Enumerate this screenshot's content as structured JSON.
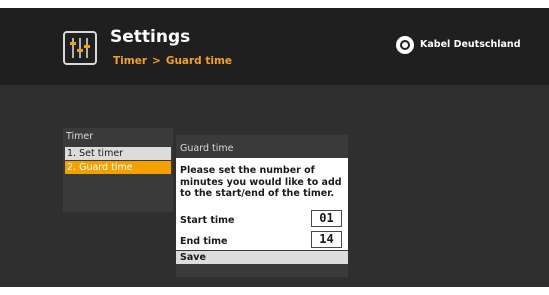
{
  "header": {
    "title": "Settings",
    "breadcrumb": {
      "parent": "Timer",
      "separator": ">",
      "current": "Guard time"
    },
    "brand": "Kabel Deutschland",
    "icons": {
      "settings": "sliders-icon",
      "brand": "eye-logo-icon"
    }
  },
  "timer_menu": {
    "title": "Timer",
    "items": [
      {
        "label": "1. Set timer",
        "state": "normal"
      },
      {
        "label": "2. Guard time",
        "state": "selected"
      }
    ]
  },
  "dialog": {
    "title": "Guard time",
    "message": "Please set the number of minutes you would like to add to the start/end of the timer.",
    "start_label": "Start time",
    "start_value": "01",
    "end_label": "End time",
    "end_value": "14",
    "save_label": "Save"
  },
  "colors": {
    "accent": "#f2a100",
    "header_bg": "#1f1f1f",
    "screen_bg": "#2f2f2f",
    "panel_bg": "#3a3a3a"
  }
}
